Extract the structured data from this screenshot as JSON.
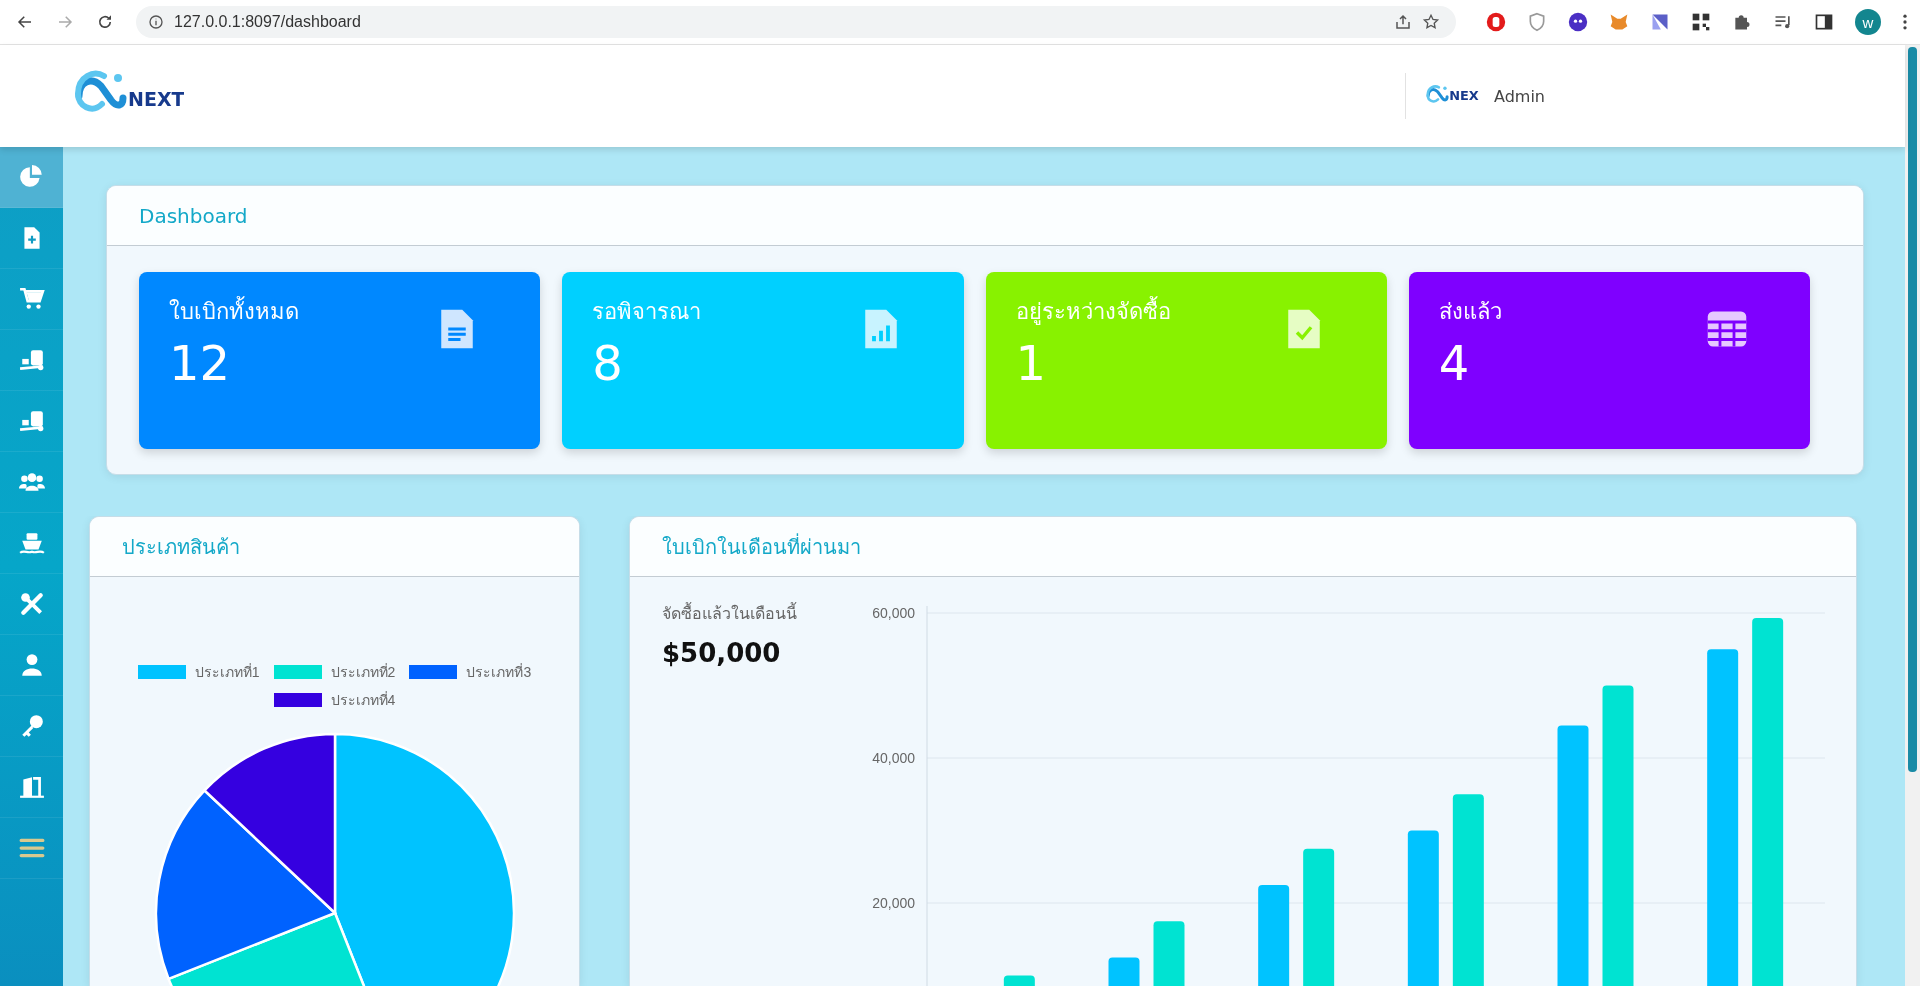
{
  "browser": {
    "url": "127.0.0.1:8097/dashboard",
    "profile_initial": "w"
  },
  "header": {
    "logo_text": "NEXT",
    "user_logo_text": "NEX",
    "user_name": "Admin"
  },
  "sidebar": {
    "items": [
      {
        "kind": "pie",
        "selected": true
      },
      {
        "kind": "file-plus",
        "selected": false
      },
      {
        "kind": "cart",
        "selected": false
      },
      {
        "kind": "dolly",
        "selected": false
      },
      {
        "kind": "dolly",
        "selected": false
      },
      {
        "kind": "users",
        "selected": false
      },
      {
        "kind": "ship",
        "selected": false
      },
      {
        "kind": "tools",
        "selected": false
      },
      {
        "kind": "user",
        "selected": false
      },
      {
        "kind": "key",
        "selected": false
      },
      {
        "kind": "door",
        "selected": false
      },
      {
        "kind": "menu",
        "selected": false
      }
    ]
  },
  "dashboard": {
    "title": "Dashboard",
    "cards": [
      {
        "label": "ใบเบิกทั้งหมด",
        "value": "12",
        "color": "#0088ff",
        "kind": "document"
      },
      {
        "label": "รอพิจารณา",
        "value": "8",
        "color": "#00d0ff",
        "kind": "report"
      },
      {
        "label": "อยู่ระหว่างจัดซื้อ",
        "value": "1",
        "color": "#88f200",
        "kind": "check"
      },
      {
        "label": "ส่งแล้ว",
        "value": "4",
        "color": "#7f00ff",
        "kind": "table"
      }
    ]
  },
  "product_types": {
    "title": "ประเภทสินค้า",
    "chart_data": {
      "type": "pie",
      "legend": "top",
      "categories": [
        "ประเภทที่1",
        "ประเภทที่2",
        "ประเภทที่3",
        "ประเภทที่4"
      ],
      "values": [
        44,
        25,
        18,
        13
      ],
      "colors": [
        "#00c3ff",
        "#00e3d2",
        "#0062ff",
        "#3500e0"
      ]
    }
  },
  "monthly_requests": {
    "title": "ใบเบิกในเดือนที่ผ่านมา",
    "summary_label": "จัดซื้อแล้วในเดือนนี้",
    "summary_value": "$50,000",
    "chart_data": {
      "type": "bar",
      "ylim": [
        0,
        60000
      ],
      "yticks": [
        {
          "value": 20000,
          "label": "20,000"
        },
        {
          "value": 40000,
          "label": "40,000"
        },
        {
          "value": 60000,
          "label": "60,000"
        }
      ],
      "series": [
        {
          "color": "#00c3ff",
          "values": [
            null,
            12500,
            22500,
            30000,
            44500,
            55000
          ]
        },
        {
          "color": "#00e3d2",
          "values": [
            10000,
            17500,
            27500,
            35000,
            50000,
            59300
          ]
        }
      ]
    }
  }
}
